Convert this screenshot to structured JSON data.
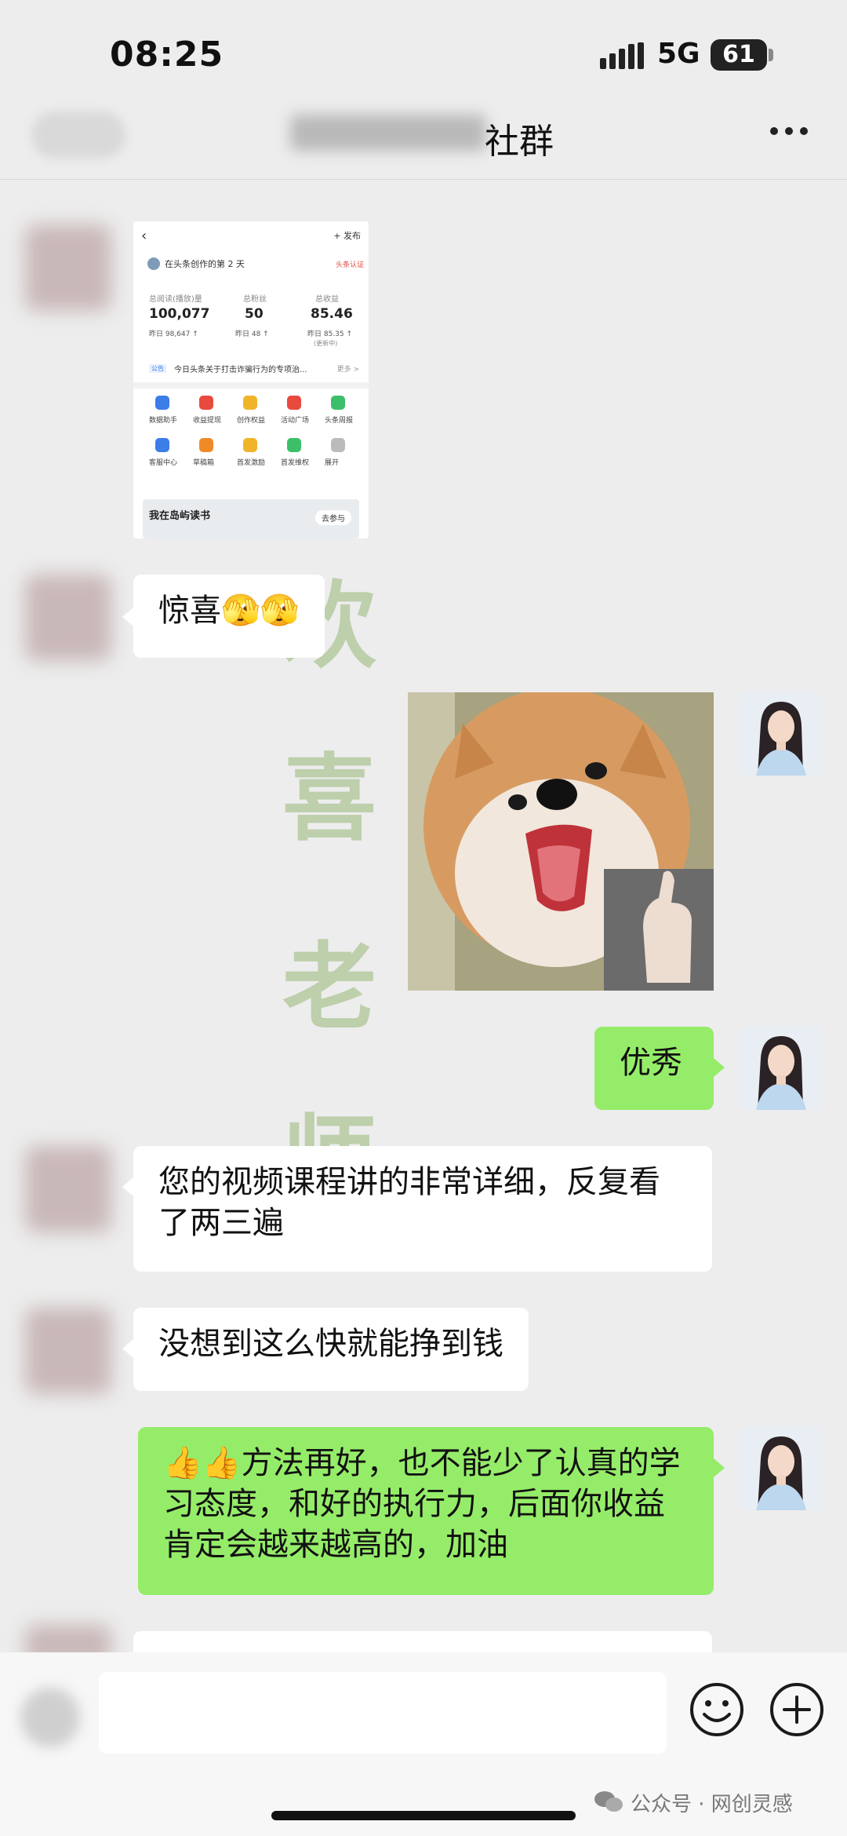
{
  "status_bar": {
    "time": "08:25",
    "network": "5G",
    "battery": "61"
  },
  "header": {
    "title": "社群"
  },
  "screenshot_card": {
    "publish": "+ 发布",
    "days_text": "在头条创作的第 2 天",
    "badge": "头条认证",
    "stats": [
      {
        "label": "总阅读(播放)量",
        "value": "100,077",
        "sub": "昨日 98,647 ↑"
      },
      {
        "label": "总粉丝",
        "value": "50",
        "sub": "昨日 48 ↑"
      },
      {
        "label": "总收益",
        "value": "85.46",
        "sub": "昨日 85.35 ↑"
      }
    ],
    "stats_note": "(更新中)",
    "notice_tag": "公告",
    "notice": "今日头条关于打击诈骗行为的专项治...",
    "notice_more": "更多 >",
    "tools": [
      {
        "label": "数据助手",
        "color": "#3d7de8"
      },
      {
        "label": "收益提现",
        "color": "#e84a3d"
      },
      {
        "label": "创作权益",
        "color": "#f0b429"
      },
      {
        "label": "活动广场",
        "color": "#e84a3d"
      },
      {
        "label": "头条周报",
        "color": "#3dbf6a"
      },
      {
        "label": "客服中心",
        "color": "#3d7de8"
      },
      {
        "label": "草稿箱",
        "color": "#f08a29"
      },
      {
        "label": "首发激励",
        "color": "#f0b429"
      },
      {
        "label": "首发维权",
        "color": "#3dbf6a"
      },
      {
        "label": "展开",
        "color": "#bbbbbb"
      }
    ],
    "banner": "我在岛屿读书",
    "banner_button": "去参与"
  },
  "messages": {
    "m1": "惊喜🫣🫣",
    "m2": "优秀",
    "m3": "您的视频课程讲的非常详细，反复看了两三遍",
    "m4": "没想到这么快就能挣到钱",
    "m5": "👍👍方法再好，也不能少了认真的学习态度，和好的执行力，后面你收益肯定会越来越高的，加油"
  },
  "watermark": [
    "欢",
    "喜",
    "老",
    "师"
  ],
  "footer": {
    "credit": "公众号 · 网创灵感"
  },
  "colors": {
    "background": "#ededed",
    "my_bubble": "#95ec69",
    "their_bubble": "#ffffff"
  }
}
